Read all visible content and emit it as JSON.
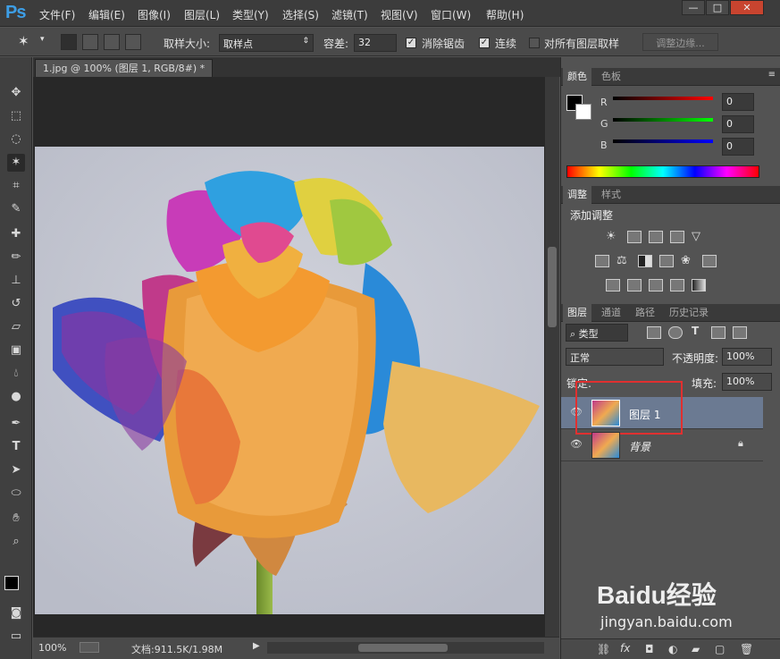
{
  "app": {
    "logo": "Ps"
  },
  "menu": [
    "文件(F)",
    "编辑(E)",
    "图像(I)",
    "图层(L)",
    "类型(Y)",
    "选择(S)",
    "滤镜(T)",
    "视图(V)",
    "窗口(W)",
    "帮助(H)"
  ],
  "window_buttons": [
    "—",
    "□",
    "✕"
  ],
  "options": {
    "sample_size_label": "取样大小:",
    "sample_size_value": "取样点",
    "tolerance_label": "容差:",
    "tolerance_value": "32",
    "anti_alias_label": "消除锯齿",
    "contiguous_label": "连续",
    "all_layers_label": "对所有图层取样",
    "refine_edge_label": "调整边缘..."
  },
  "document": {
    "tab_title": "1.jpg @ 100% (图层 1, RGB/8#) *"
  },
  "status": {
    "zoom": "100%",
    "doc_info": "文档:911.5K/1.98M"
  },
  "color_panel": {
    "tabs": [
      "颜色",
      "色板"
    ],
    "channels": [
      {
        "label": "R",
        "value": "0"
      },
      {
        "label": "G",
        "value": "0"
      },
      {
        "label": "B",
        "value": "0"
      }
    ]
  },
  "adjust_panel": {
    "tabs": [
      "调整",
      "样式"
    ],
    "title": "添加调整"
  },
  "layers_panel": {
    "tabs": [
      "图层",
      "通道",
      "路径",
      "历史记录"
    ],
    "filter_label": "类型",
    "blend_mode": "正常",
    "opacity_label": "不透明度:",
    "opacity_value": "100%",
    "lock_label": "锁定:",
    "fill_label": "填充:",
    "fill_value": "100%",
    "layers": [
      {
        "name": "图层 1",
        "selected": true
      },
      {
        "name": "背景",
        "selected": false
      }
    ]
  },
  "watermark": {
    "brand": "Baidu经验",
    "url": "jingyan.baidu.com"
  },
  "colors": {
    "accent": "#3d9ee6",
    "selected_layer": "#6b7a92",
    "highlight_box": "#e03030"
  }
}
